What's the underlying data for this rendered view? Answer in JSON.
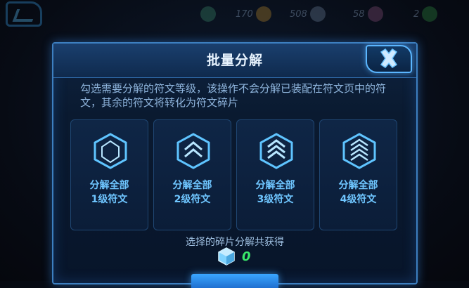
{
  "modal": {
    "title": "批量分解",
    "description": "勾选需要分解的符文等级，该操作不会分解已装配在符文页中的符文，其余的符文将转化为符文碎片",
    "options": [
      {
        "line1": "分解全部",
        "line2": "1级符文"
      },
      {
        "line1": "分解全部",
        "line2": "2级符文"
      },
      {
        "line1": "分解全部",
        "line2": "3级符文"
      },
      {
        "line1": "分解全部",
        "line2": "4级符文"
      }
    ],
    "gain_label": "选择的碎片分解共获得",
    "gain_value": "0"
  },
  "topbar": {
    "stats": [
      "170",
      "508",
      "58",
      "2"
    ]
  },
  "colors": {
    "accent": "#6fc6ff",
    "gain": "#39e86a",
    "border": "#3d7fc0"
  }
}
